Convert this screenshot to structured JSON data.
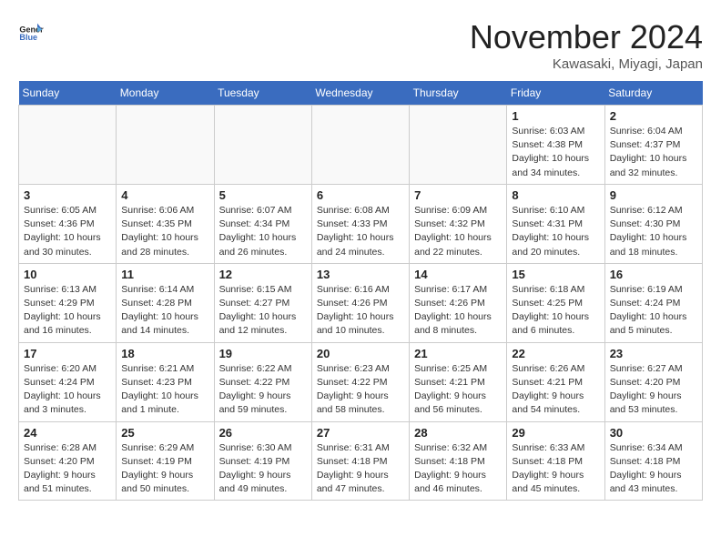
{
  "logo": {
    "line1": "General",
    "line2": "Blue"
  },
  "title": "November 2024",
  "location": "Kawasaki, Miyagi, Japan",
  "days_of_week": [
    "Sunday",
    "Monday",
    "Tuesday",
    "Wednesday",
    "Thursday",
    "Friday",
    "Saturday"
  ],
  "weeks": [
    [
      {
        "day": "",
        "info": ""
      },
      {
        "day": "",
        "info": ""
      },
      {
        "day": "",
        "info": ""
      },
      {
        "day": "",
        "info": ""
      },
      {
        "day": "",
        "info": ""
      },
      {
        "day": "1",
        "info": "Sunrise: 6:03 AM\nSunset: 4:38 PM\nDaylight: 10 hours\nand 34 minutes."
      },
      {
        "day": "2",
        "info": "Sunrise: 6:04 AM\nSunset: 4:37 PM\nDaylight: 10 hours\nand 32 minutes."
      }
    ],
    [
      {
        "day": "3",
        "info": "Sunrise: 6:05 AM\nSunset: 4:36 PM\nDaylight: 10 hours\nand 30 minutes."
      },
      {
        "day": "4",
        "info": "Sunrise: 6:06 AM\nSunset: 4:35 PM\nDaylight: 10 hours\nand 28 minutes."
      },
      {
        "day": "5",
        "info": "Sunrise: 6:07 AM\nSunset: 4:34 PM\nDaylight: 10 hours\nand 26 minutes."
      },
      {
        "day": "6",
        "info": "Sunrise: 6:08 AM\nSunset: 4:33 PM\nDaylight: 10 hours\nand 24 minutes."
      },
      {
        "day": "7",
        "info": "Sunrise: 6:09 AM\nSunset: 4:32 PM\nDaylight: 10 hours\nand 22 minutes."
      },
      {
        "day": "8",
        "info": "Sunrise: 6:10 AM\nSunset: 4:31 PM\nDaylight: 10 hours\nand 20 minutes."
      },
      {
        "day": "9",
        "info": "Sunrise: 6:12 AM\nSunset: 4:30 PM\nDaylight: 10 hours\nand 18 minutes."
      }
    ],
    [
      {
        "day": "10",
        "info": "Sunrise: 6:13 AM\nSunset: 4:29 PM\nDaylight: 10 hours\nand 16 minutes."
      },
      {
        "day": "11",
        "info": "Sunrise: 6:14 AM\nSunset: 4:28 PM\nDaylight: 10 hours\nand 14 minutes."
      },
      {
        "day": "12",
        "info": "Sunrise: 6:15 AM\nSunset: 4:27 PM\nDaylight: 10 hours\nand 12 minutes."
      },
      {
        "day": "13",
        "info": "Sunrise: 6:16 AM\nSunset: 4:26 PM\nDaylight: 10 hours\nand 10 minutes."
      },
      {
        "day": "14",
        "info": "Sunrise: 6:17 AM\nSunset: 4:26 PM\nDaylight: 10 hours\nand 8 minutes."
      },
      {
        "day": "15",
        "info": "Sunrise: 6:18 AM\nSunset: 4:25 PM\nDaylight: 10 hours\nand 6 minutes."
      },
      {
        "day": "16",
        "info": "Sunrise: 6:19 AM\nSunset: 4:24 PM\nDaylight: 10 hours\nand 5 minutes."
      }
    ],
    [
      {
        "day": "17",
        "info": "Sunrise: 6:20 AM\nSunset: 4:24 PM\nDaylight: 10 hours\nand 3 minutes."
      },
      {
        "day": "18",
        "info": "Sunrise: 6:21 AM\nSunset: 4:23 PM\nDaylight: 10 hours\nand 1 minute."
      },
      {
        "day": "19",
        "info": "Sunrise: 6:22 AM\nSunset: 4:22 PM\nDaylight: 9 hours\nand 59 minutes."
      },
      {
        "day": "20",
        "info": "Sunrise: 6:23 AM\nSunset: 4:22 PM\nDaylight: 9 hours\nand 58 minutes."
      },
      {
        "day": "21",
        "info": "Sunrise: 6:25 AM\nSunset: 4:21 PM\nDaylight: 9 hours\nand 56 minutes."
      },
      {
        "day": "22",
        "info": "Sunrise: 6:26 AM\nSunset: 4:21 PM\nDaylight: 9 hours\nand 54 minutes."
      },
      {
        "day": "23",
        "info": "Sunrise: 6:27 AM\nSunset: 4:20 PM\nDaylight: 9 hours\nand 53 minutes."
      }
    ],
    [
      {
        "day": "24",
        "info": "Sunrise: 6:28 AM\nSunset: 4:20 PM\nDaylight: 9 hours\nand 51 minutes."
      },
      {
        "day": "25",
        "info": "Sunrise: 6:29 AM\nSunset: 4:19 PM\nDaylight: 9 hours\nand 50 minutes."
      },
      {
        "day": "26",
        "info": "Sunrise: 6:30 AM\nSunset: 4:19 PM\nDaylight: 9 hours\nand 49 minutes."
      },
      {
        "day": "27",
        "info": "Sunrise: 6:31 AM\nSunset: 4:18 PM\nDaylight: 9 hours\nand 47 minutes."
      },
      {
        "day": "28",
        "info": "Sunrise: 6:32 AM\nSunset: 4:18 PM\nDaylight: 9 hours\nand 46 minutes."
      },
      {
        "day": "29",
        "info": "Sunrise: 6:33 AM\nSunset: 4:18 PM\nDaylight: 9 hours\nand 45 minutes."
      },
      {
        "day": "30",
        "info": "Sunrise: 6:34 AM\nSunset: 4:18 PM\nDaylight: 9 hours\nand 43 minutes."
      }
    ]
  ]
}
